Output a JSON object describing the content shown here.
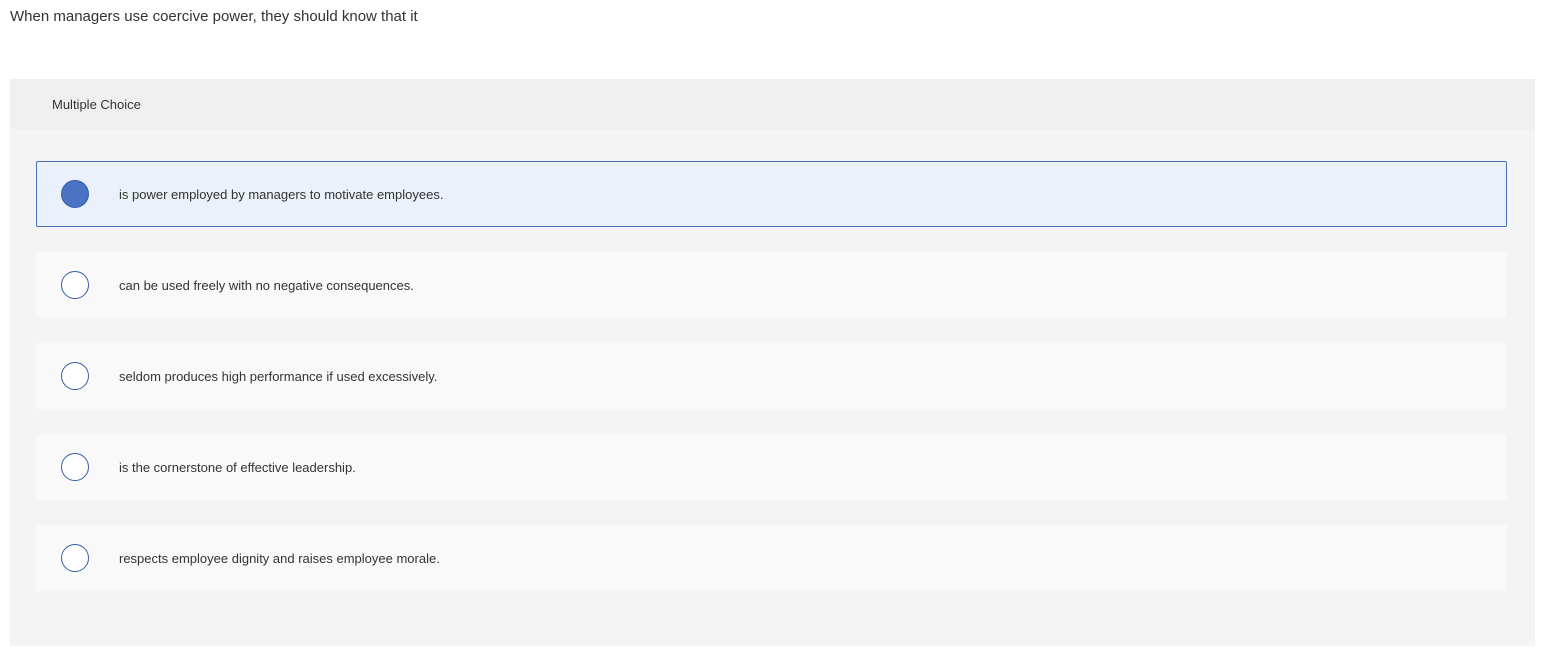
{
  "question": {
    "prompt": "When managers use coercive power, they should know that it",
    "type_label": "Multiple Choice"
  },
  "choices": [
    {
      "text": "is power employed by managers to motivate employees.",
      "selected": true
    },
    {
      "text": "can be used freely with no negative consequences.",
      "selected": false
    },
    {
      "text": "seldom produces high performance if used excessively.",
      "selected": false
    },
    {
      "text": "is the cornerstone of effective leadership.",
      "selected": false
    },
    {
      "text": "respects employee dignity and raises employee morale.",
      "selected": false
    }
  ],
  "colors": {
    "selected_fill": "#4a73c4",
    "radio_border": "#355fa8",
    "selected_background": "#eaf1fa"
  }
}
